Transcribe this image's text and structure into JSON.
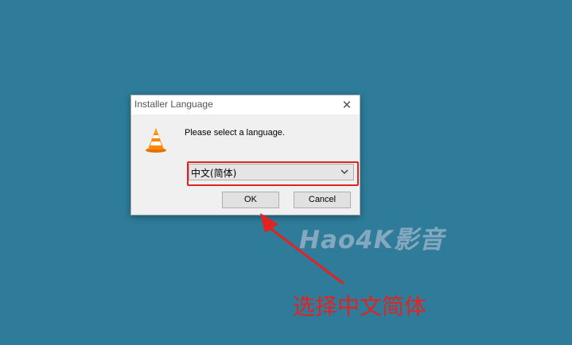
{
  "dialog": {
    "title": "Installer Language",
    "close_glyph": "✕",
    "prompt": "Please select a language.",
    "language_select": {
      "value": "中文(简体)"
    },
    "ok_label": "OK",
    "cancel_label": "Cancel",
    "icon": "vlc-cone-icon"
  },
  "overlay": {
    "watermark": "Hao4K影音",
    "annotation": "选择中文简体",
    "annotation_color": "#e32222"
  },
  "colors": {
    "desktop": "#2e7c99",
    "dialog_bg": "#f0f0f0",
    "highlight": "#e32222"
  }
}
